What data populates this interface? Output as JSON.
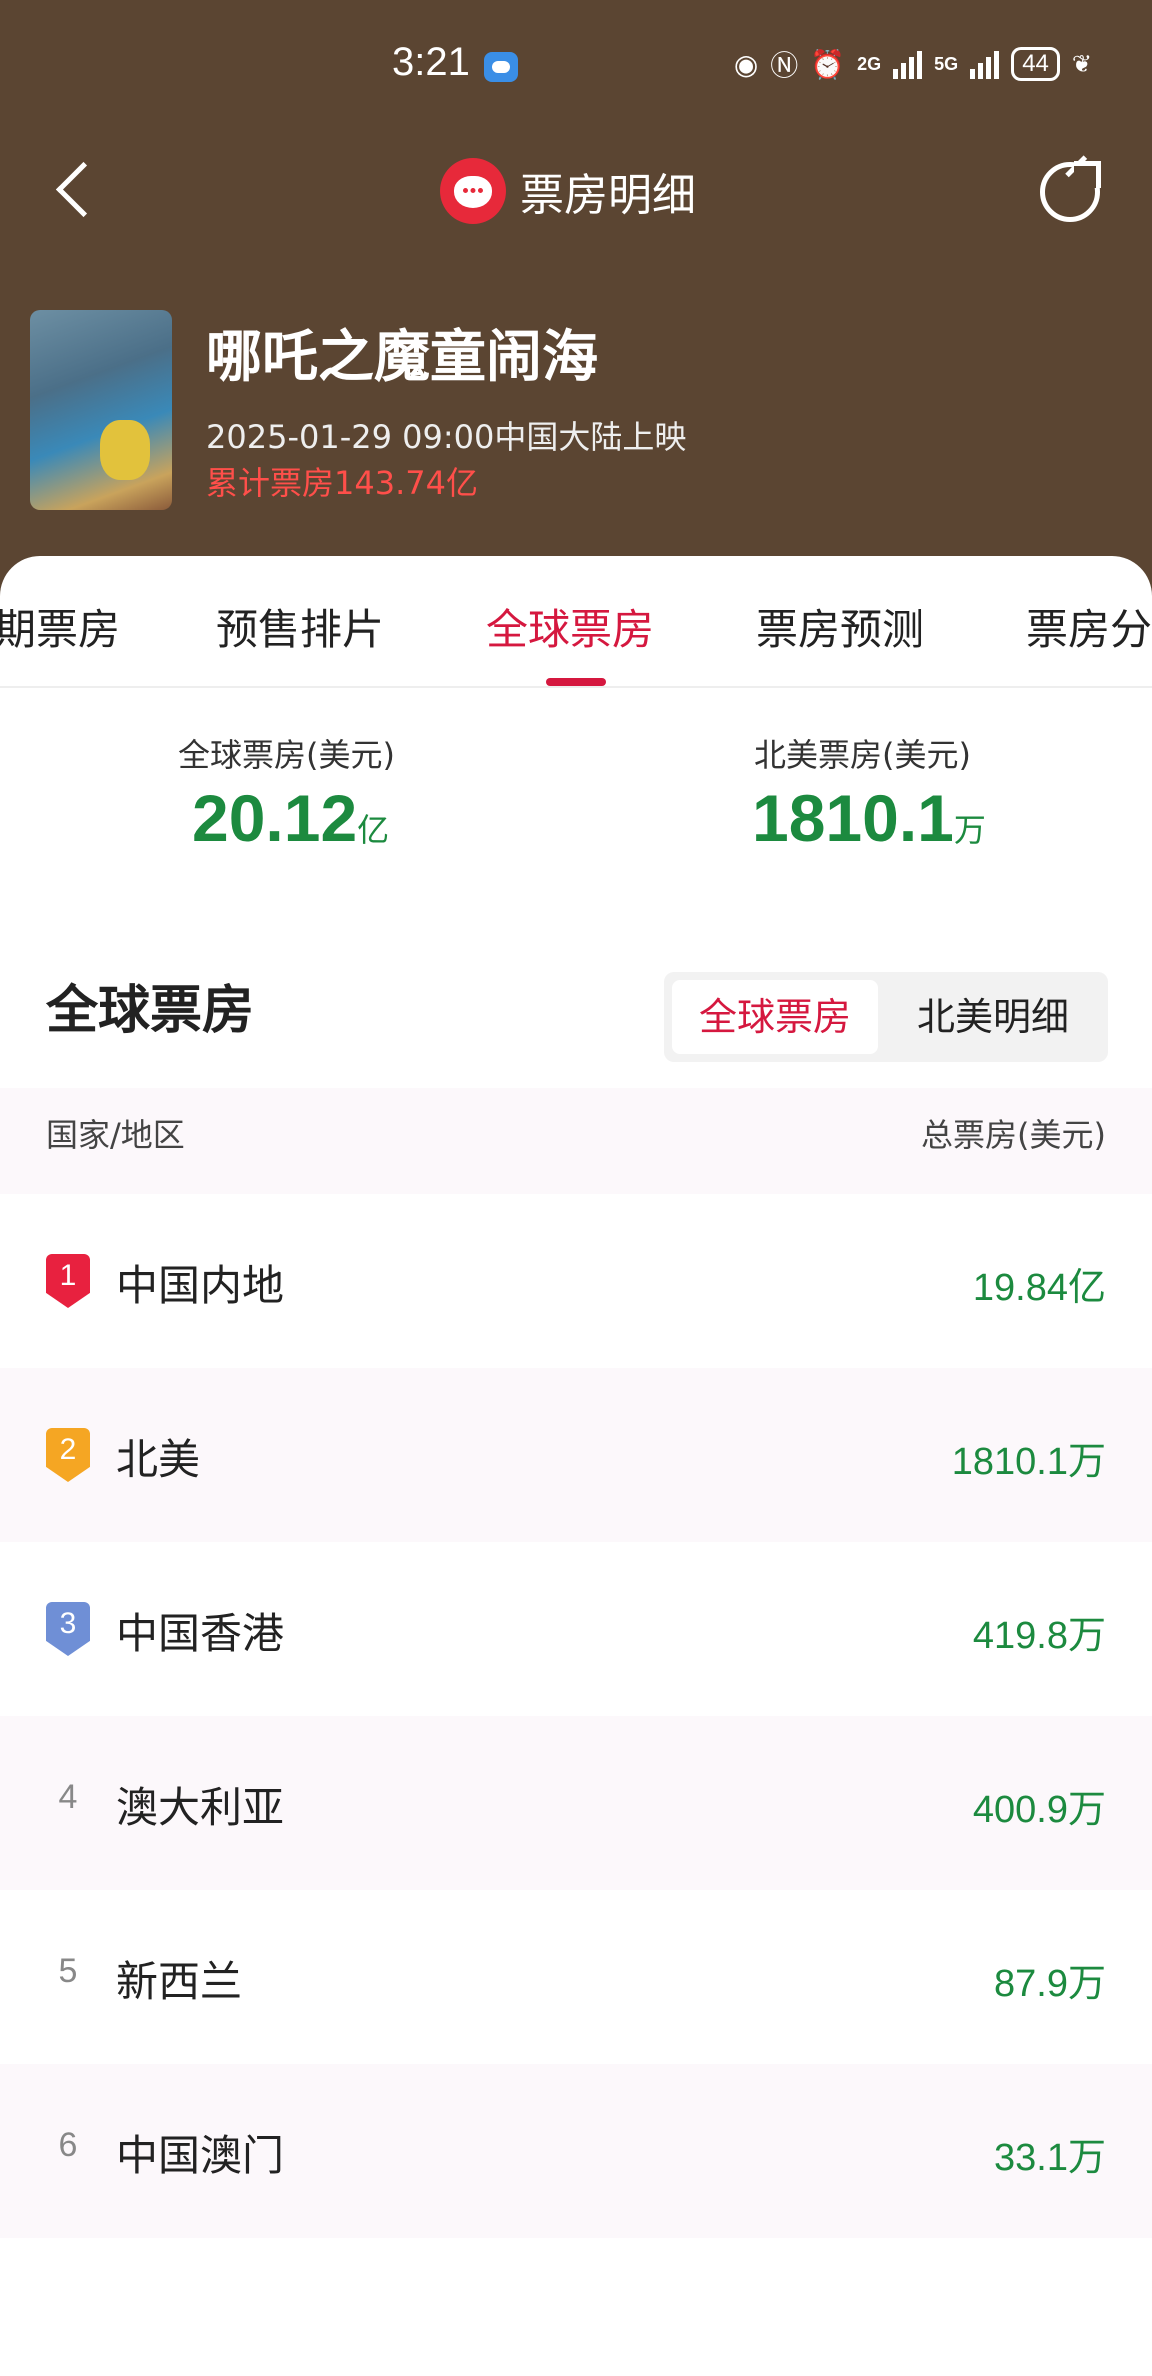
{
  "status_bar": {
    "time": "3:21",
    "battery": "44",
    "signal_1": "2G",
    "signal_2": "5G",
    "icons": [
      "weather-icon",
      "eye-icon",
      "nfc-icon",
      "alarm-icon",
      "signal-icon",
      "battery-icon",
      "leaf-icon"
    ]
  },
  "nav": {
    "title": "票房明细",
    "colors": {
      "header_bg": "#5b4532",
      "brand_red": "#e7293a"
    }
  },
  "movie": {
    "title": "哪吒之魔童闹海",
    "release": "2025-01-29 09:00中国大陆上映",
    "cumulative": "累计票房143.74亿"
  },
  "tabs": [
    "期票房",
    "预售排片",
    "全球票房",
    "票房预测",
    "票房分"
  ],
  "active_tab_index": 2,
  "summary": {
    "global_label": "全球票房(美元)",
    "global_value": "20.12",
    "global_unit": "亿",
    "na_label": "北美票房(美元)",
    "na_value": "1810.1",
    "na_unit": "万",
    "value_color": "#1c8a3f"
  },
  "section": {
    "title": "全球票房",
    "toggle_active": "全球票房",
    "toggle_inactive": "北美明细"
  },
  "table": {
    "col_region": "国家/地区",
    "col_total": "总票房(美元)",
    "rows": [
      {
        "rank": "1",
        "country": "中国内地",
        "amount": "19.84亿",
        "badge_color": "#e8213f"
      },
      {
        "rank": "2",
        "country": "北美",
        "amount": "1810.1万",
        "badge_color": "#f5a623"
      },
      {
        "rank": "3",
        "country": "中国香港",
        "amount": "419.8万",
        "badge_color": "#6f8fd6"
      },
      {
        "rank": "4",
        "country": "澳大利亚",
        "amount": "400.9万"
      },
      {
        "rank": "5",
        "country": "新西兰",
        "amount": "87.9万"
      },
      {
        "rank": "6",
        "country": "中国澳门",
        "amount": "33.1万"
      }
    ]
  }
}
